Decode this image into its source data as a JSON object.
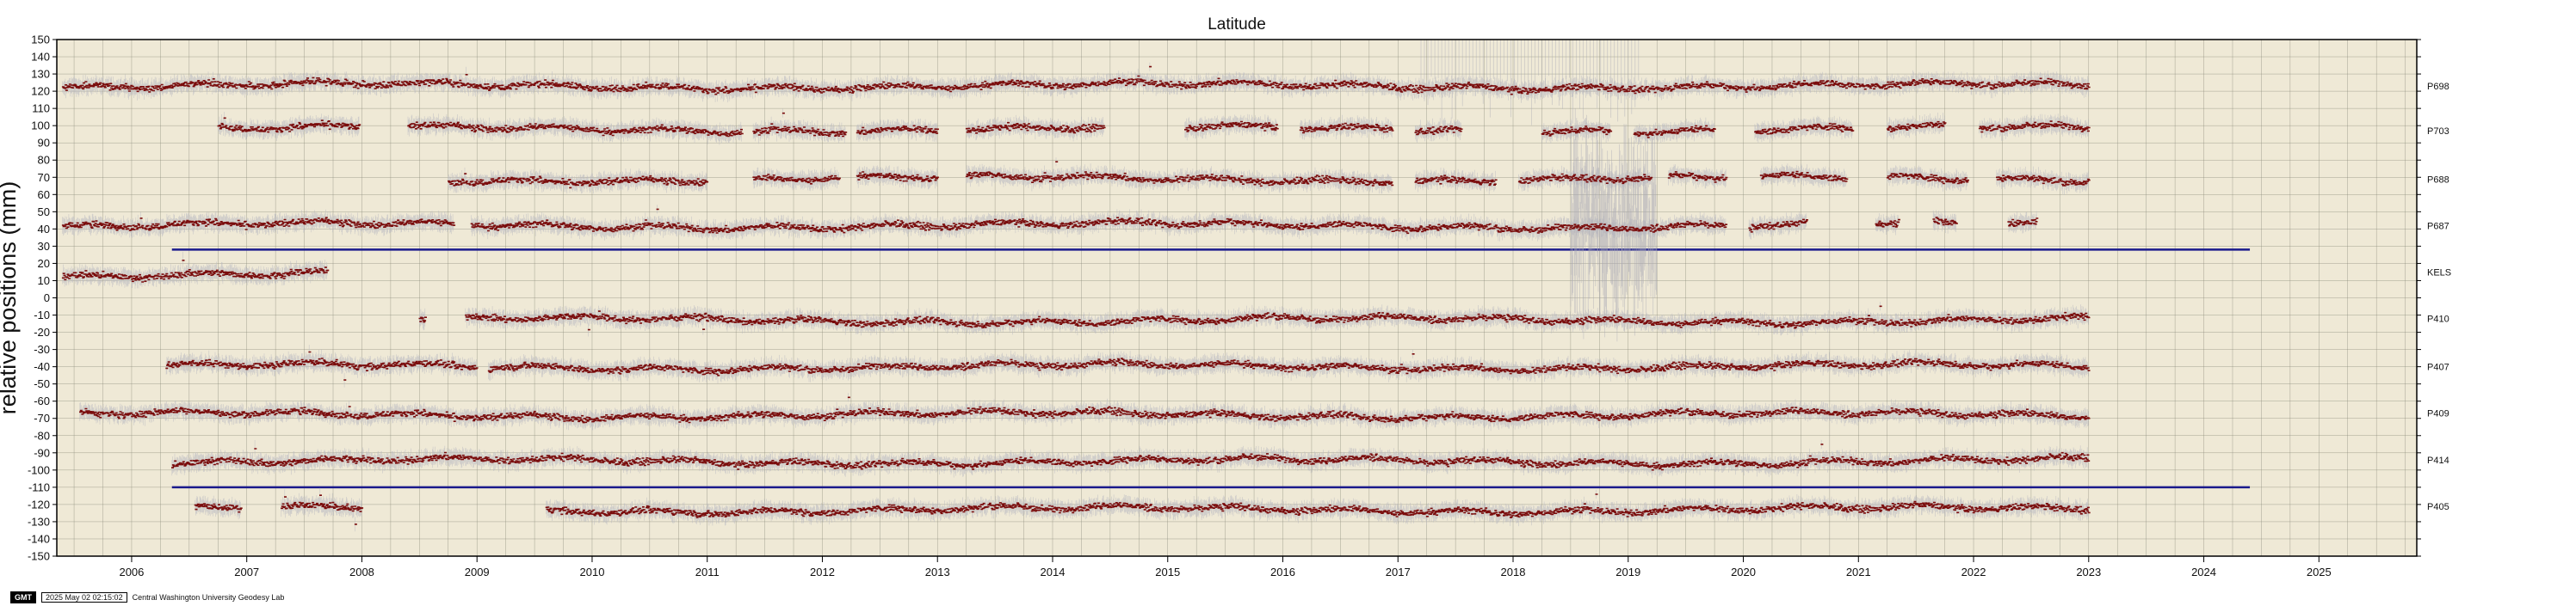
{
  "chart_data": {
    "type": "scatter",
    "title": "Latitude",
    "ylabel": "relative positions (mm)",
    "xlabel": "",
    "xlim": [
      2005.35,
      2025.85
    ],
    "ylim": [
      -150,
      150
    ],
    "x_ticks": [
      2006,
      2007,
      2008,
      2009,
      2010,
      2011,
      2012,
      2013,
      2014,
      2015,
      2016,
      2017,
      2018,
      2019,
      2020,
      2021,
      2022,
      2023,
      2024,
      2025
    ],
    "y_ticks": [
      150,
      140,
      130,
      120,
      110,
      100,
      90,
      80,
      70,
      60,
      50,
      40,
      30,
      20,
      10,
      0,
      -10,
      -20,
      -30,
      -40,
      -50,
      -60,
      -70,
      -80,
      -90,
      -100,
      -110,
      -120,
      -130,
      -140,
      -150
    ],
    "grid": true,
    "colors": {
      "points": "#7a0c0c",
      "error_bars": "#b8b8c0",
      "reference_line": "#1a1a8c",
      "background": "#efe9d6"
    },
    "series": [
      {
        "name": "P698",
        "label_y": 123,
        "offset": 123,
        "segments": [
          [
            2005.4,
            2023.0
          ]
        ]
      },
      {
        "name": "P703",
        "label_y": 97,
        "offset": 98,
        "segments": [
          [
            2006.75,
            2007.98
          ],
          [
            2008.4,
            2011.3
          ],
          [
            2011.4,
            2012.2
          ],
          [
            2012.3,
            2013.0
          ],
          [
            2013.25,
            2014.45
          ],
          [
            2015.15,
            2015.95
          ],
          [
            2016.15,
            2016.95
          ],
          [
            2017.15,
            2017.55
          ],
          [
            2018.25,
            2018.85
          ],
          [
            2019.05,
            2019.75
          ],
          [
            2020.1,
            2020.95
          ],
          [
            2021.25,
            2021.75
          ],
          [
            2022.05,
            2023.0
          ]
        ]
      },
      {
        "name": "P688",
        "label_y": 69,
        "offset": 69,
        "segments": [
          [
            2008.75,
            2011.0
          ],
          [
            2011.4,
            2012.15
          ],
          [
            2012.3,
            2013.0
          ],
          [
            2013.25,
            2016.95
          ],
          [
            2017.15,
            2017.85
          ],
          [
            2018.05,
            2019.2
          ],
          [
            2019.35,
            2019.85
          ],
          [
            2020.15,
            2020.9
          ],
          [
            2021.25,
            2021.95
          ],
          [
            2022.2,
            2023.0
          ]
        ]
      },
      {
        "name": "P687",
        "label_y": 42,
        "offset": 42,
        "segments": [
          [
            2005.4,
            2008.8
          ],
          [
            2008.95,
            2019.85
          ],
          [
            2020.05,
            2020.55
          ],
          [
            2021.15,
            2021.35
          ],
          [
            2021.65,
            2021.85
          ],
          [
            2022.3,
            2022.55
          ]
        ]
      },
      {
        "name": "KELS",
        "label_y": 15,
        "offset": 13,
        "segments": [
          [
            2005.4,
            2007.7
          ]
        ]
      },
      {
        "name": "P410",
        "label_y": -12,
        "offset": -13,
        "segments": [
          [
            2008.5,
            2008.55
          ],
          [
            2008.9,
            2021.4
          ],
          [
            2021.4,
            2023.0
          ]
        ]
      },
      {
        "name": "P407",
        "label_y": -40,
        "offset": -40,
        "segments": [
          [
            2006.3,
            2009.0
          ],
          [
            2009.1,
            2023.0
          ]
        ]
      },
      {
        "name": "P409",
        "label_y": -67,
        "offset": -68,
        "segments": [
          [
            2005.55,
            2006.1
          ],
          [
            2006.1,
            2023.0
          ]
        ]
      },
      {
        "name": "P414",
        "label_y": -94,
        "offset": -95,
        "segments": [
          [
            2006.35,
            2023.0
          ]
        ]
      },
      {
        "name": "P405",
        "label_y": -121,
        "offset": -123,
        "segments": [
          [
            2006.55,
            2006.95
          ],
          [
            2007.3,
            2008.0
          ],
          [
            2009.6,
            2023.0
          ]
        ]
      }
    ],
    "reference_lines": [
      {
        "y": 28,
        "x_range": [
          2006.35,
          2024.4
        ]
      },
      {
        "y": -110,
        "x_range": [
          2006.35,
          2024.4
        ]
      }
    ]
  },
  "footer": {
    "logo_text": "GMT",
    "timestamp": "2025 May 02 02:15:02",
    "credit": "Central Washington University Geodesy Lab"
  }
}
